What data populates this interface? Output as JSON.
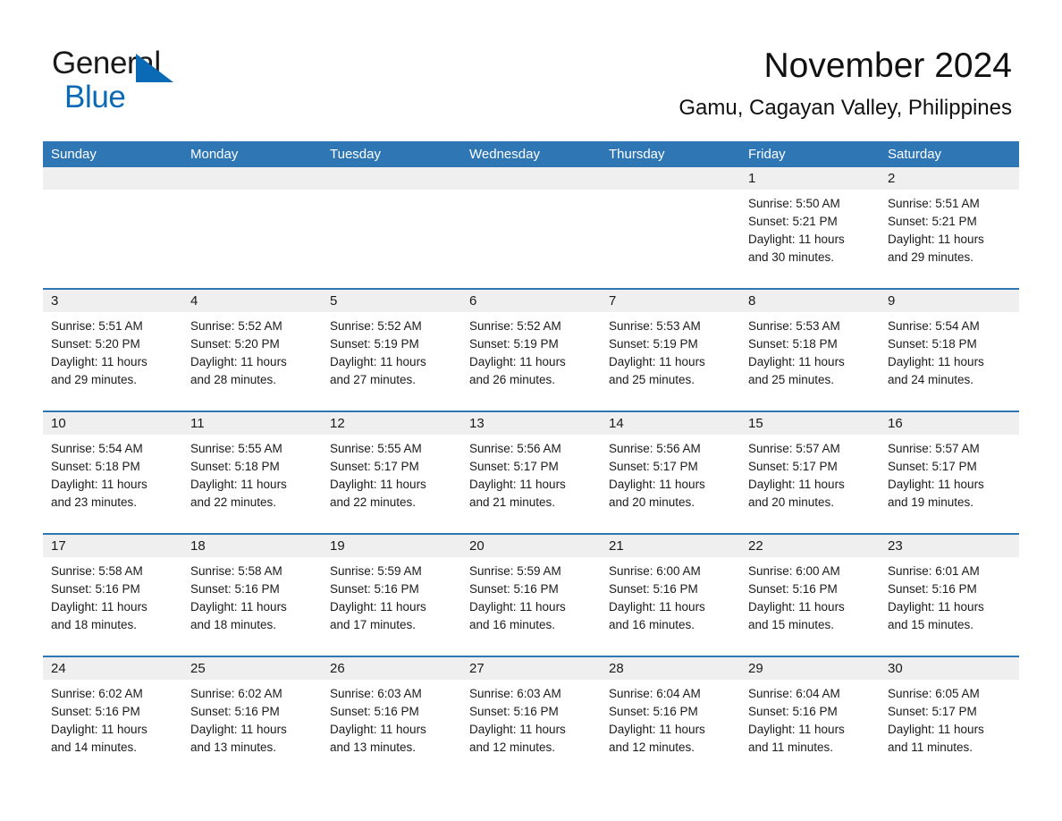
{
  "brand": {
    "name_part1": "General",
    "name_part2": "Blue",
    "triangle_color": "#0a6ab5"
  },
  "header": {
    "title": "November 2024",
    "subtitle": "Gamu, Cagayan Valley, Philippines"
  },
  "colors": {
    "header_blue": "#2f76b5",
    "daynum_band": "#efefef",
    "text": "#1a1a1a"
  },
  "calendar": {
    "day_headers": [
      "Sunday",
      "Monday",
      "Tuesday",
      "Wednesday",
      "Thursday",
      "Friday",
      "Saturday"
    ],
    "weeks": [
      [
        {
          "day": "",
          "lines": []
        },
        {
          "day": "",
          "lines": []
        },
        {
          "day": "",
          "lines": []
        },
        {
          "day": "",
          "lines": []
        },
        {
          "day": "",
          "lines": []
        },
        {
          "day": "1",
          "lines": [
            "Sunrise: 5:50 AM",
            "Sunset: 5:21 PM",
            "Daylight: 11 hours",
            "and 30 minutes."
          ]
        },
        {
          "day": "2",
          "lines": [
            "Sunrise: 5:51 AM",
            "Sunset: 5:21 PM",
            "Daylight: 11 hours",
            "and 29 minutes."
          ]
        }
      ],
      [
        {
          "day": "3",
          "lines": [
            "Sunrise: 5:51 AM",
            "Sunset: 5:20 PM",
            "Daylight: 11 hours",
            "and 29 minutes."
          ]
        },
        {
          "day": "4",
          "lines": [
            "Sunrise: 5:52 AM",
            "Sunset: 5:20 PM",
            "Daylight: 11 hours",
            "and 28 minutes."
          ]
        },
        {
          "day": "5",
          "lines": [
            "Sunrise: 5:52 AM",
            "Sunset: 5:19 PM",
            "Daylight: 11 hours",
            "and 27 minutes."
          ]
        },
        {
          "day": "6",
          "lines": [
            "Sunrise: 5:52 AM",
            "Sunset: 5:19 PM",
            "Daylight: 11 hours",
            "and 26 minutes."
          ]
        },
        {
          "day": "7",
          "lines": [
            "Sunrise: 5:53 AM",
            "Sunset: 5:19 PM",
            "Daylight: 11 hours",
            "and 25 minutes."
          ]
        },
        {
          "day": "8",
          "lines": [
            "Sunrise: 5:53 AM",
            "Sunset: 5:18 PM",
            "Daylight: 11 hours",
            "and 25 minutes."
          ]
        },
        {
          "day": "9",
          "lines": [
            "Sunrise: 5:54 AM",
            "Sunset: 5:18 PM",
            "Daylight: 11 hours",
            "and 24 minutes."
          ]
        }
      ],
      [
        {
          "day": "10",
          "lines": [
            "Sunrise: 5:54 AM",
            "Sunset: 5:18 PM",
            "Daylight: 11 hours",
            "and 23 minutes."
          ]
        },
        {
          "day": "11",
          "lines": [
            "Sunrise: 5:55 AM",
            "Sunset: 5:18 PM",
            "Daylight: 11 hours",
            "and 22 minutes."
          ]
        },
        {
          "day": "12",
          "lines": [
            "Sunrise: 5:55 AM",
            "Sunset: 5:17 PM",
            "Daylight: 11 hours",
            "and 22 minutes."
          ]
        },
        {
          "day": "13",
          "lines": [
            "Sunrise: 5:56 AM",
            "Sunset: 5:17 PM",
            "Daylight: 11 hours",
            "and 21 minutes."
          ]
        },
        {
          "day": "14",
          "lines": [
            "Sunrise: 5:56 AM",
            "Sunset: 5:17 PM",
            "Daylight: 11 hours",
            "and 20 minutes."
          ]
        },
        {
          "day": "15",
          "lines": [
            "Sunrise: 5:57 AM",
            "Sunset: 5:17 PM",
            "Daylight: 11 hours",
            "and 20 minutes."
          ]
        },
        {
          "day": "16",
          "lines": [
            "Sunrise: 5:57 AM",
            "Sunset: 5:17 PM",
            "Daylight: 11 hours",
            "and 19 minutes."
          ]
        }
      ],
      [
        {
          "day": "17",
          "lines": [
            "Sunrise: 5:58 AM",
            "Sunset: 5:16 PM",
            "Daylight: 11 hours",
            "and 18 minutes."
          ]
        },
        {
          "day": "18",
          "lines": [
            "Sunrise: 5:58 AM",
            "Sunset: 5:16 PM",
            "Daylight: 11 hours",
            "and 18 minutes."
          ]
        },
        {
          "day": "19",
          "lines": [
            "Sunrise: 5:59 AM",
            "Sunset: 5:16 PM",
            "Daylight: 11 hours",
            "and 17 minutes."
          ]
        },
        {
          "day": "20",
          "lines": [
            "Sunrise: 5:59 AM",
            "Sunset: 5:16 PM",
            "Daylight: 11 hours",
            "and 16 minutes."
          ]
        },
        {
          "day": "21",
          "lines": [
            "Sunrise: 6:00 AM",
            "Sunset: 5:16 PM",
            "Daylight: 11 hours",
            "and 16 minutes."
          ]
        },
        {
          "day": "22",
          "lines": [
            "Sunrise: 6:00 AM",
            "Sunset: 5:16 PM",
            "Daylight: 11 hours",
            "and 15 minutes."
          ]
        },
        {
          "day": "23",
          "lines": [
            "Sunrise: 6:01 AM",
            "Sunset: 5:16 PM",
            "Daylight: 11 hours",
            "and 15 minutes."
          ]
        }
      ],
      [
        {
          "day": "24",
          "lines": [
            "Sunrise: 6:02 AM",
            "Sunset: 5:16 PM",
            "Daylight: 11 hours",
            "and 14 minutes."
          ]
        },
        {
          "day": "25",
          "lines": [
            "Sunrise: 6:02 AM",
            "Sunset: 5:16 PM",
            "Daylight: 11 hours",
            "and 13 minutes."
          ]
        },
        {
          "day": "26",
          "lines": [
            "Sunrise: 6:03 AM",
            "Sunset: 5:16 PM",
            "Daylight: 11 hours",
            "and 13 minutes."
          ]
        },
        {
          "day": "27",
          "lines": [
            "Sunrise: 6:03 AM",
            "Sunset: 5:16 PM",
            "Daylight: 11 hours",
            "and 12 minutes."
          ]
        },
        {
          "day": "28",
          "lines": [
            "Sunrise: 6:04 AM",
            "Sunset: 5:16 PM",
            "Daylight: 11 hours",
            "and 12 minutes."
          ]
        },
        {
          "day": "29",
          "lines": [
            "Sunrise: 6:04 AM",
            "Sunset: 5:16 PM",
            "Daylight: 11 hours",
            "and 11 minutes."
          ]
        },
        {
          "day": "30",
          "lines": [
            "Sunrise: 6:05 AM",
            "Sunset: 5:17 PM",
            "Daylight: 11 hours",
            "and 11 minutes."
          ]
        }
      ]
    ]
  }
}
